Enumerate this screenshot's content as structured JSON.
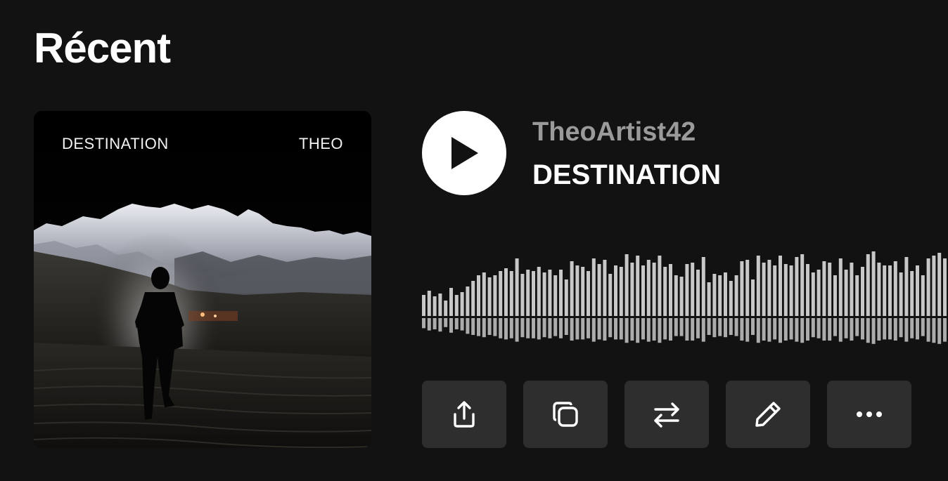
{
  "section": {
    "title": "Récent"
  },
  "track": {
    "artist": "TheoArtist42",
    "title": "DESTINATION",
    "cover": {
      "left_text": "DESTINATION",
      "right_text": "THEO"
    }
  },
  "player": {
    "play_icon": "play-icon"
  },
  "waveform": {
    "bar_color": "#c8c8c8",
    "levels": [
      0.3,
      0.36,
      0.28,
      0.32,
      0.22,
      0.4,
      0.3,
      0.34,
      0.42,
      0.5,
      0.58,
      0.62,
      0.55,
      0.58,
      0.64,
      0.68,
      0.64,
      0.82,
      0.6,
      0.66,
      0.64,
      0.7,
      0.62,
      0.66,
      0.58,
      0.66,
      0.52,
      0.78,
      0.72,
      0.7,
      0.64,
      0.82,
      0.74,
      0.8,
      0.6,
      0.72,
      0.7,
      0.88,
      0.76,
      0.86,
      0.72,
      0.8,
      0.76,
      0.86,
      0.7,
      0.74,
      0.58,
      0.56,
      0.74,
      0.76,
      0.66,
      0.84,
      0.48,
      0.6,
      0.58,
      0.62,
      0.5,
      0.58,
      0.78,
      0.8,
      0.52,
      0.86,
      0.76,
      0.8,
      0.72,
      0.86,
      0.74,
      0.72,
      0.84,
      0.88,
      0.74,
      0.62,
      0.66,
      0.78,
      0.76,
      0.58,
      0.82,
      0.66,
      0.76,
      0.58,
      0.7,
      0.88,
      0.92,
      0.76,
      0.72,
      0.72,
      0.78,
      0.62,
      0.84,
      0.64,
      0.72,
      0.58,
      0.82,
      0.86,
      0.9,
      0.82
    ],
    "levels_bottom": [
      0.18,
      0.22,
      0.2,
      0.24,
      0.16,
      0.26,
      0.2,
      0.22,
      0.28,
      0.3,
      0.32,
      0.34,
      0.3,
      0.32,
      0.36,
      0.38,
      0.36,
      0.42,
      0.34,
      0.36,
      0.36,
      0.38,
      0.34,
      0.36,
      0.32,
      0.36,
      0.3,
      0.4,
      0.38,
      0.38,
      0.36,
      0.42,
      0.38,
      0.4,
      0.34,
      0.38,
      0.38,
      0.44,
      0.4,
      0.44,
      0.38,
      0.42,
      0.4,
      0.44,
      0.38,
      0.4,
      0.32,
      0.32,
      0.4,
      0.4,
      0.36,
      0.42,
      0.3,
      0.34,
      0.32,
      0.34,
      0.3,
      0.32,
      0.4,
      0.42,
      0.3,
      0.44,
      0.4,
      0.42,
      0.38,
      0.44,
      0.4,
      0.38,
      0.42,
      0.44,
      0.4,
      0.34,
      0.36,
      0.4,
      0.4,
      0.32,
      0.42,
      0.36,
      0.4,
      0.32,
      0.38,
      0.44,
      0.46,
      0.4,
      0.38,
      0.38,
      0.4,
      0.34,
      0.42,
      0.36,
      0.38,
      0.32,
      0.42,
      0.44,
      0.46,
      0.42
    ]
  },
  "actions": [
    {
      "name": "share-button",
      "icon": "share-icon"
    },
    {
      "name": "duplicate-button",
      "icon": "copy-icon"
    },
    {
      "name": "swap-button",
      "icon": "arrows-swap-icon"
    },
    {
      "name": "edit-button",
      "icon": "pencil-icon"
    },
    {
      "name": "more-button",
      "icon": "more-horizontal-icon"
    }
  ]
}
